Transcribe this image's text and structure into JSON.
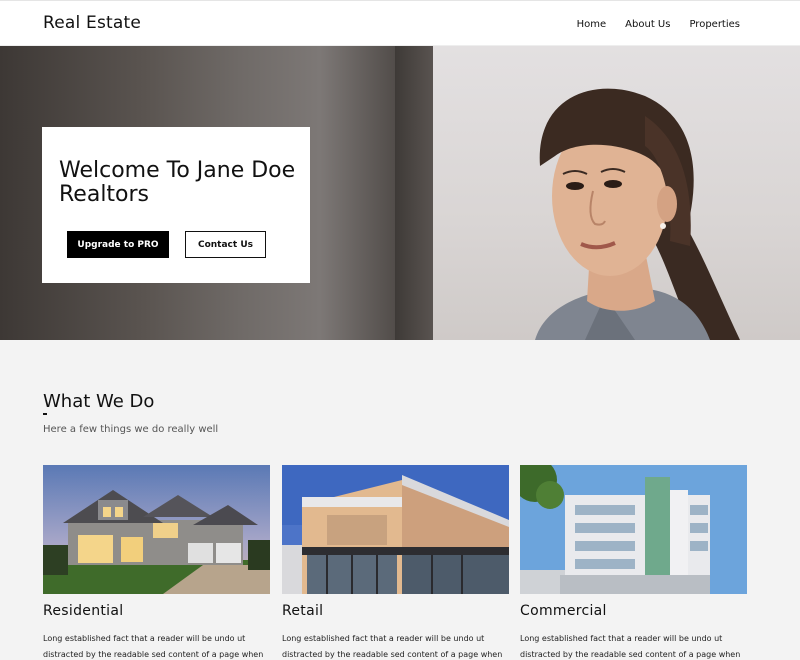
{
  "header": {
    "brand": "Real Estate",
    "nav": [
      {
        "label": "Home"
      },
      {
        "label": "About Us"
      },
      {
        "label": "Properties"
      }
    ]
  },
  "hero": {
    "title": "Welcome To Jane Doe Realtors",
    "primary_button": "Upgrade to PRO",
    "secondary_button": "Contact Us"
  },
  "services": {
    "title": "What We Do",
    "dash": "-",
    "subtitle": "Here a few things we do really well",
    "cards": [
      {
        "title": "Residential",
        "desc": "Long established fact that a reader will be undo ut distracted by the readable sed content of a page when"
      },
      {
        "title": "Retail",
        "desc": "Long established fact that a reader will be undo ut distracted by the readable sed content of a page when"
      },
      {
        "title": "Commercial",
        "desc": "Long established fact that a reader will be undo ut distracted by the readable sed content of a page when"
      }
    ]
  },
  "colors": {
    "accent": "#000000",
    "background": "#f3f3f3"
  }
}
